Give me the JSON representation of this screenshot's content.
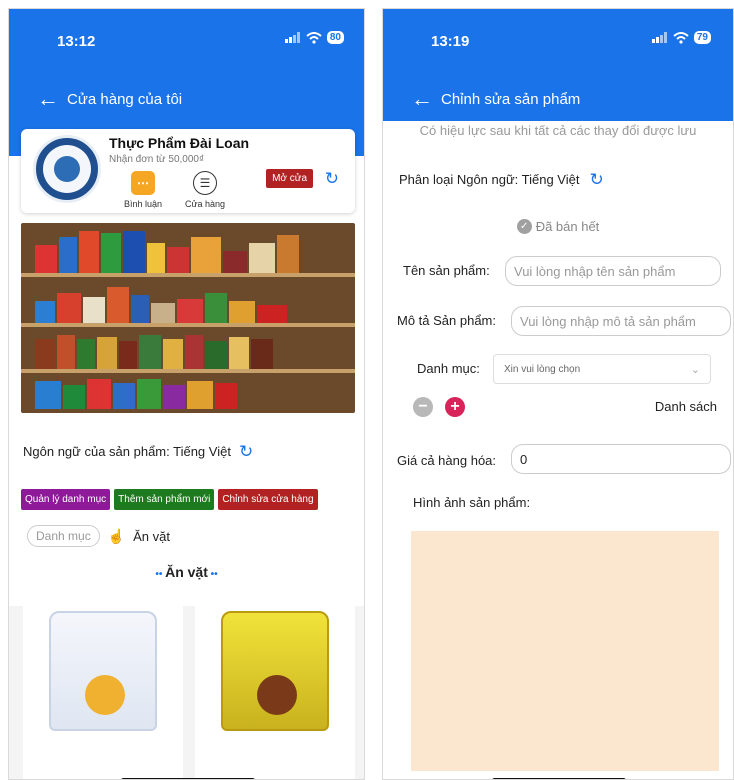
{
  "left": {
    "time": "13:12",
    "battery": "80",
    "nav_title": "Cửa hàng của tôi",
    "store": {
      "name": "Thực Phẩm Đài Loan",
      "subtitle": "Nhận đơn từ 50,000₫",
      "comment_label": "Bình luận",
      "shop_label": "Cửa hàng",
      "open_label": "Mở cửa"
    },
    "product_language": "Ngôn ngữ của sản phẩm: Tiếng Việt",
    "buttons": {
      "manage_categories": "Quản lý danh mục",
      "add_product": "Thêm sản phẩm mới",
      "edit_store": "Chỉnh sửa cửa hàng"
    },
    "colors": {
      "manage_categories": "#8e1a9a",
      "add_product": "#1e7a1e",
      "edit_store": "#b22222"
    },
    "filter": {
      "category_pill": "Danh mục",
      "selected_tag": "Ăn vặt"
    },
    "section_title": "Ăn vặt"
  },
  "right": {
    "time": "13:19",
    "battery": "79",
    "nav_title": "Chỉnh sửa sản phẩm",
    "notice": "Có hiệu lực sau khi tất cả các thay đổi được lưu",
    "language_label": "Phân loại Ngôn ngữ: Tiếng Việt",
    "sold_out": "Đã bán hết",
    "name_label": "Tên sản phẩm:",
    "name_placeholder": "Vui lòng nhập tên sản phẩm",
    "desc_label": "Mô tả Sản phẩm:",
    "desc_placeholder": "Vui lòng nhập mô tả sản phẩm",
    "category_label": "Danh mục:",
    "category_select": "Xin vui lòng chọn",
    "list_label": "Danh sách",
    "price_label": "Giá cả hàng hóa:",
    "price_value": "0",
    "image_label": "Hình ảnh sản phẩm:"
  },
  "accent_color": "#1a73e8"
}
